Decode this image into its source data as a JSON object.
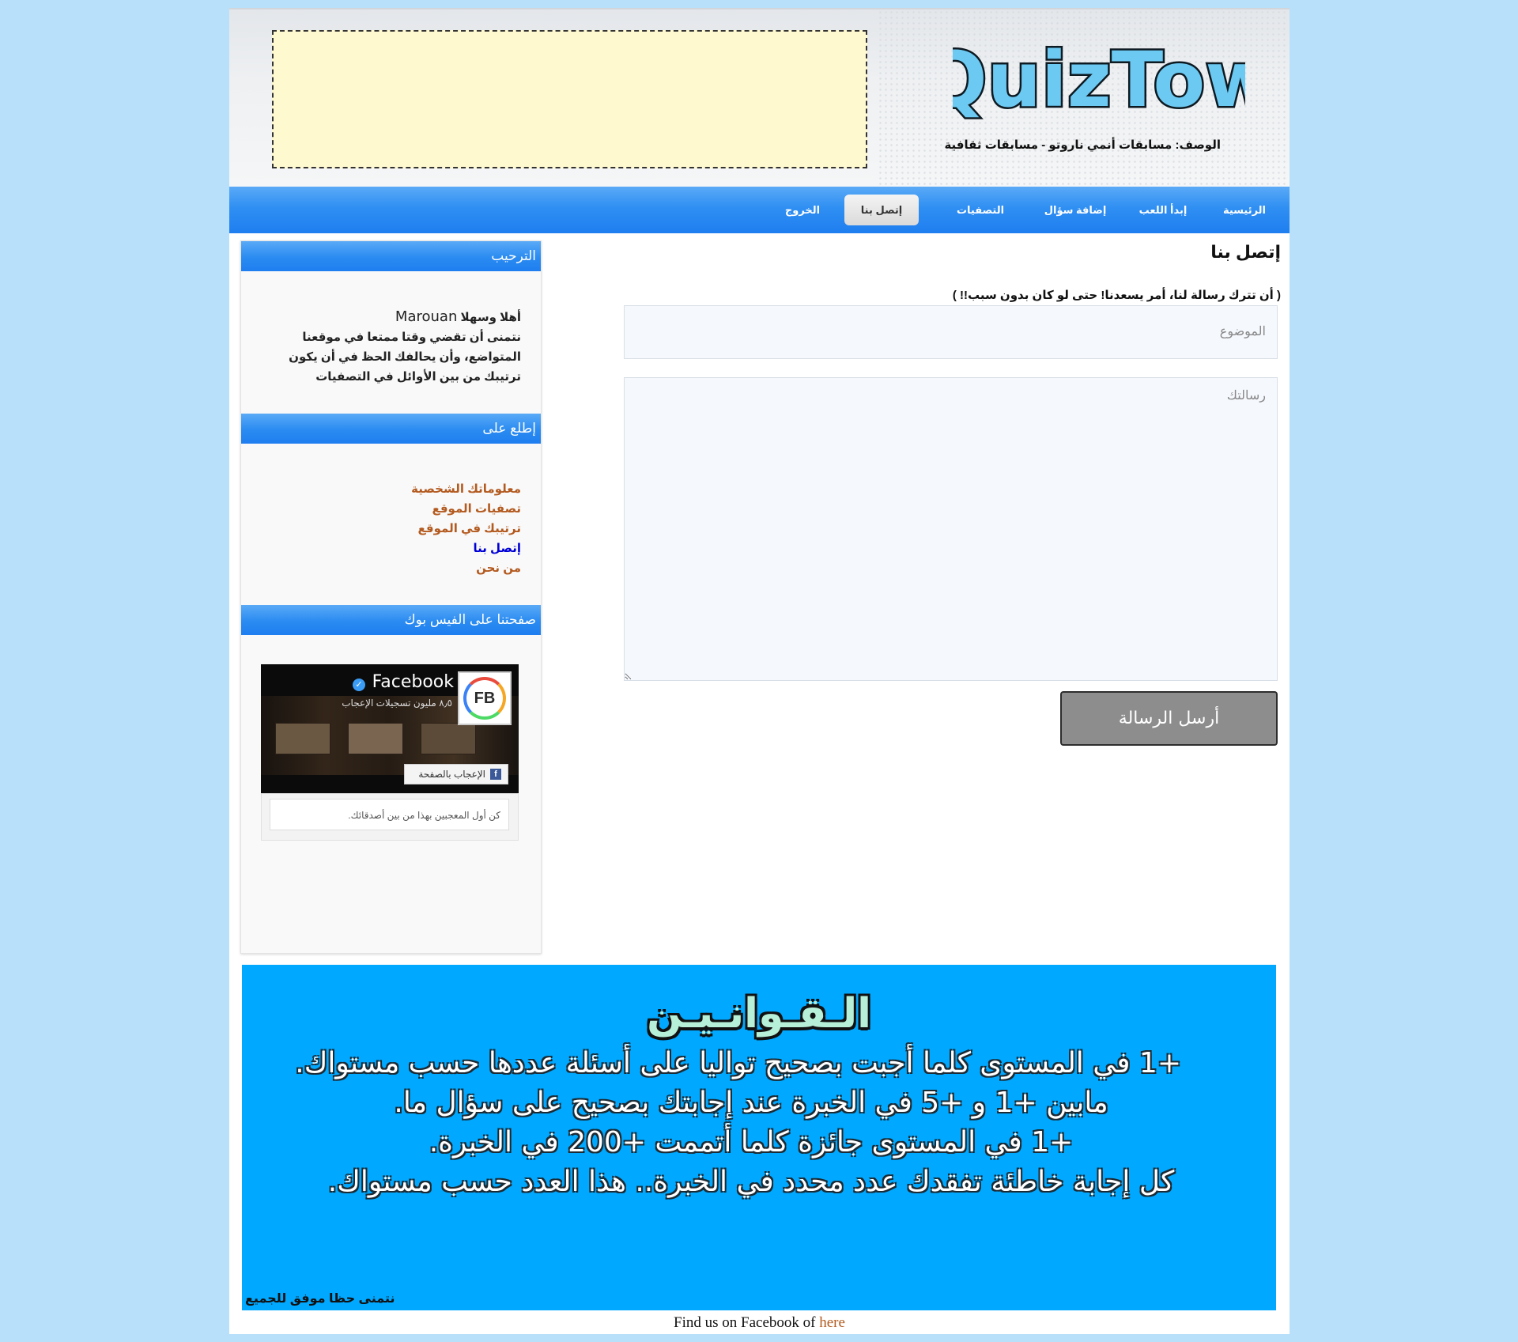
{
  "header": {
    "logo_text": "QuizTow",
    "description": "الوصف: مسابقات أنمي ناروتو - مسابقات ثقافية"
  },
  "nav": {
    "items": [
      {
        "label": "الرئيسية"
      },
      {
        "label": "إبدأ اللعب"
      },
      {
        "label": "إضافة سؤال"
      },
      {
        "label": "التصفيات"
      },
      {
        "label": "إتصل بنا",
        "active": true
      },
      {
        "label": "الخروج"
      }
    ]
  },
  "sidebar": {
    "welcome": {
      "heading": "الترحيب",
      "greeting": "أهلا وسهلا",
      "username": "Marouan",
      "text": "نتمنى أن تقضي وقتا ممتعا في موقعنا المتواضع، وأن يحالفك الحظ في أن يكون ترتيبك من بين الأوائل في التصفيات"
    },
    "browse": {
      "heading": "إطلع على",
      "links": [
        {
          "label": "معلوماتك الشخصية"
        },
        {
          "label": "تصفيات الموقع"
        },
        {
          "label": "ترتيبك في الموقع"
        },
        {
          "label": "إتصل بنا",
          "current": true
        },
        {
          "label": "من نحن"
        }
      ]
    },
    "facebook": {
      "heading": "صفحتنا على الفيس بوك",
      "page_name": "Facebook",
      "avatar_text": "FB",
      "likes": "٨٫٥ مليون تسجيلات الإعجاب",
      "like_button": "الإعجاب بالصفحة",
      "friends_text": "كن أول المعجبين بهذا من بين أصدقائك."
    }
  },
  "main": {
    "title": "إتصل بنا",
    "note": "( أن تترك رسالة لنا، أمر يسعدنا! حتى لو كان بدون سبب!! )",
    "subject_placeholder": "الموضوع",
    "message_placeholder": "رسالتك",
    "send_label": "أرسل الرسالة"
  },
  "rules": {
    "title": "الـقـوانـيـن",
    "lines": [
      "+1 في المستوى كلما أجبت بصحيح تواليا على أسئلة عددها حسب مستواك.",
      "مابين +1 و +5 في الخبرة عند إجابتك بصحيح على سؤال ما.",
      "+1 في المستوى جائزة كلما أتممت +200 في الخبرة.",
      "كل إجابة خاطئة تفقدك عدد محدد في الخبرة.. هذا العدد حسب مستواك."
    ],
    "footer": "نتمنى حظا موفق للجميع"
  },
  "footer": {
    "text": "Find us on Facebook of",
    "link_label": "here"
  },
  "colors": {
    "page_bg": "#b9e0fa",
    "nav_blue": "#2f8ff2",
    "rules_bg": "#00a8ff",
    "ad_bg": "#fff9d0",
    "link": "#b35a1f",
    "current_link": "#0000d6",
    "button": "#8d8d8d"
  }
}
